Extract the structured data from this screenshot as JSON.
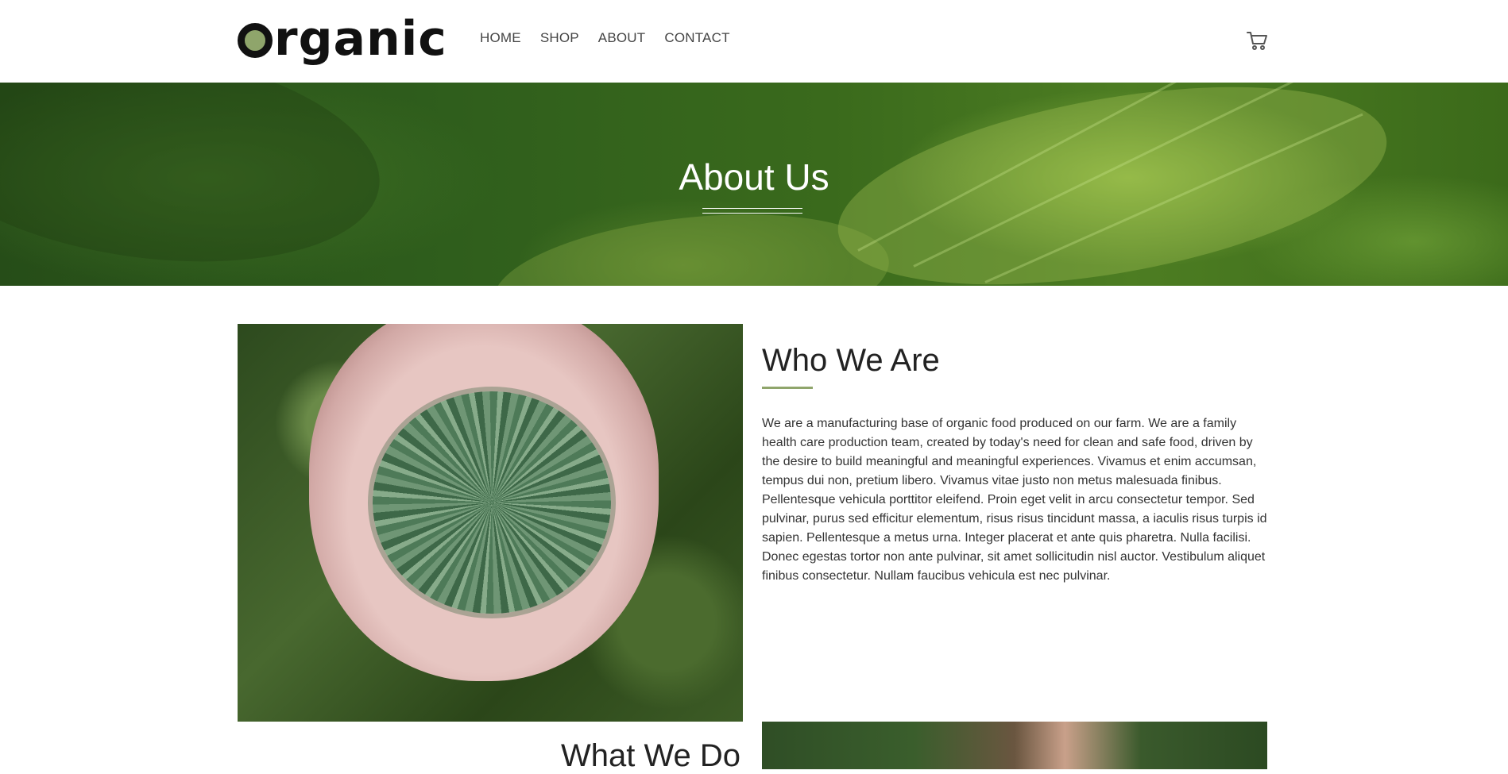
{
  "logo": {
    "text": "rganic"
  },
  "nav": {
    "items": [
      "HOME",
      "SHOP",
      "ABOUT",
      "CONTACT"
    ]
  },
  "cart": {
    "icon": "shopping-cart-icon"
  },
  "banner": {
    "title": "About Us"
  },
  "who": {
    "title": "Who We Are",
    "text": "We are a manufacturing base of organic food produced on our farm. We are a family health care production team, created by today's need for clean and safe food, driven by the desire to build meaningful and meaningful experiences. Vivamus et enim accumsan, tempus dui non, pretium libero. Vivamus vitae justo non metus malesuada finibus. Pellentesque vehicula porttitor eleifend. Proin eget velit in arcu consectetur tempor. Sed pulvinar, purus sed efficitur elementum, risus risus tincidunt massa, a iaculis risus turpis id sapien. Pellentesque a metus urna. Integer placerat et ante quis pharetra. Nulla facilisi. Donec egestas tortor non ante pulvinar, sit amet sollicitudin nisl auctor. Vestibulum aliquet finibus consectetur. Nullam faucibus vehicula est nec pulvinar."
  },
  "what": {
    "title": "What We Do"
  },
  "colors": {
    "accent": "#8fa56b",
    "text": "#222222"
  }
}
